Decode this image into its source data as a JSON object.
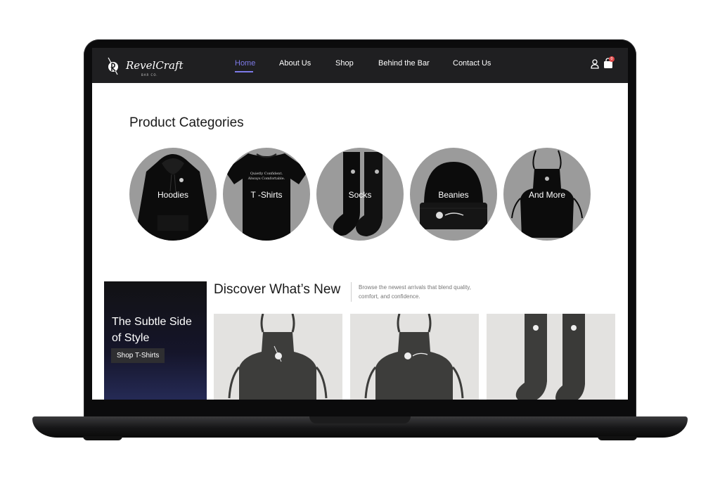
{
  "nav": {
    "logo_text": "RevelCraft",
    "logo_sub": "BAR CO.",
    "links": [
      {
        "label": "Home",
        "active": true
      },
      {
        "label": "About Us"
      },
      {
        "label": "Shop"
      },
      {
        "label": "Behind the Bar"
      },
      {
        "label": "Contact Us"
      }
    ],
    "icons": [
      "user-icon",
      "shopping-bag-icon"
    ],
    "cart_count": "0"
  },
  "categories": {
    "title": "Product Categories",
    "items": [
      {
        "label": "Hoodies"
      },
      {
        "label": "T -Shirts",
        "print_line_1": "Quietly Confident.",
        "print_line_2": "Always Comfortable."
      },
      {
        "label": "Socks"
      },
      {
        "label": "Beanies"
      },
      {
        "label": "And More"
      }
    ]
  },
  "promo": {
    "title": "The Subtle Side of Style",
    "button_label": "Shop T-Shirts"
  },
  "whats_new": {
    "title": "Discover What’s New",
    "description": "Browse the newest arrivals that blend quality, comfort, and confidence.",
    "products": [
      "apron",
      "apron",
      "socks"
    ]
  },
  "colors": {
    "nav_bg": "#1f1f21",
    "accent": "#7d7ae8",
    "category_bg": "#9b9b9b",
    "product_bg": "#e3e2e0",
    "badge": "#e04848"
  }
}
